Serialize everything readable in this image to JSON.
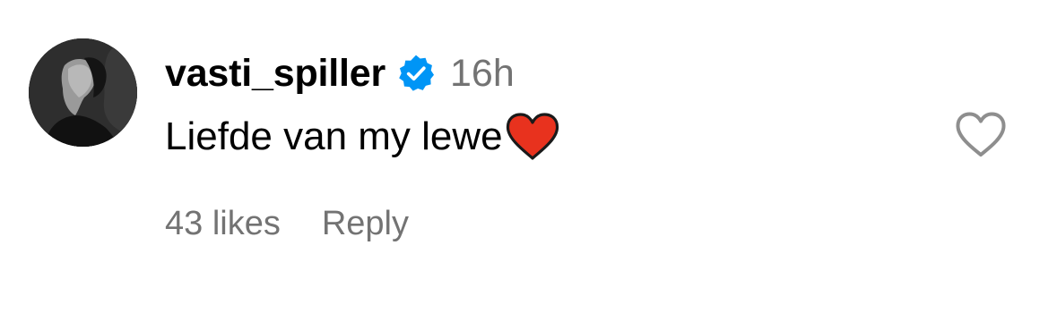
{
  "comment": {
    "username": "vasti_spiller",
    "verified": true,
    "timestamp": "16h",
    "text": "Liefde van my lewe",
    "emoji_icon": "red-heart-emoji",
    "likes_label": "43 likes",
    "reply_label": "Reply",
    "like_icon": "heart-outline-icon"
  },
  "colors": {
    "verified_blue": "#0095F6",
    "secondary_text": "#737373",
    "heart_red": "#E8321E",
    "like_outline": "#8e8e8e"
  }
}
